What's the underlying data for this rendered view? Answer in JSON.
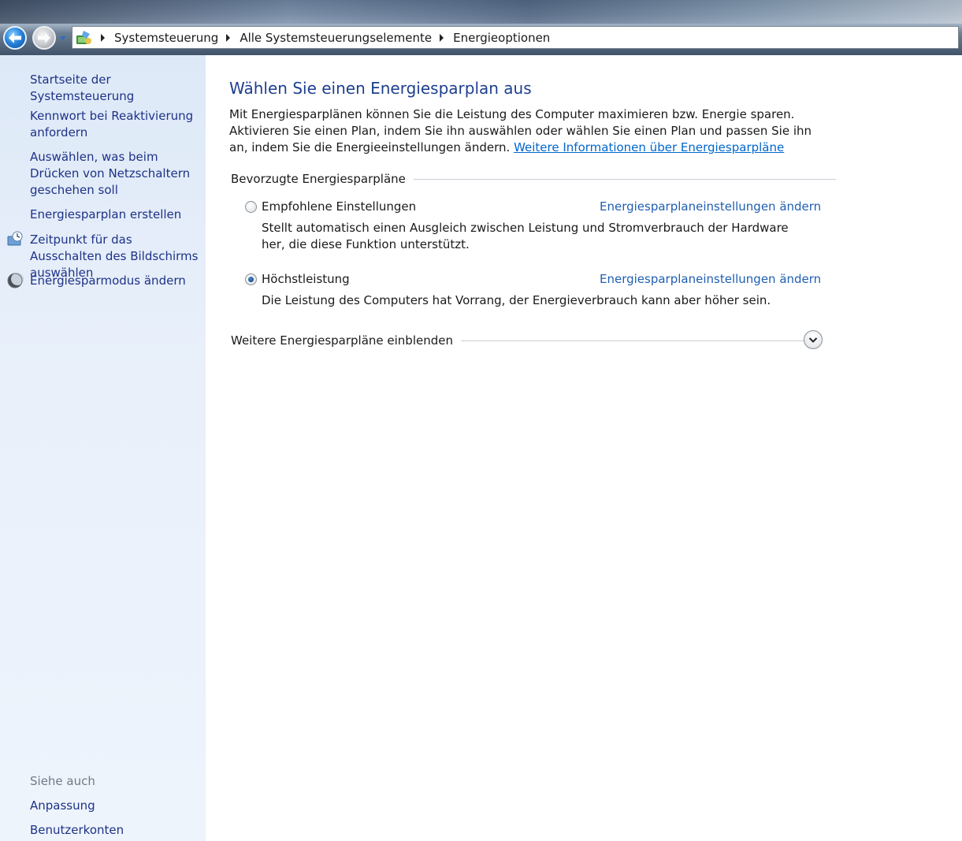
{
  "addressbar": {
    "breadcrumbs": [
      "Systemsteuerung",
      "Alle Systemsteuerungselemente",
      "Energieoptionen"
    ]
  },
  "sidebar": {
    "items": [
      {
        "label": "Startseite der Systemsteuerung",
        "icon": null
      },
      {
        "label": "Kennwort bei Reaktivierung anfordern",
        "icon": null
      },
      {
        "label": "Auswählen, was beim Drücken von Netzschaltern geschehen soll",
        "icon": null
      },
      {
        "label": "Energiesparplan erstellen",
        "icon": null
      },
      {
        "label": "Zeitpunkt für das Ausschalten des Bildschirms auswählen",
        "icon": "display-timer-icon"
      },
      {
        "label": "Energiesparmodus ändern",
        "icon": "moon-icon"
      }
    ],
    "see_also": {
      "heading": "Siehe auch",
      "items": [
        "Anpassung",
        "Benutzerkonten"
      ]
    }
  },
  "main": {
    "title": "Wählen Sie einen Energiesparplan aus",
    "intro": "Mit Energiesparplänen können Sie die Leistung des Computer maximieren bzw. Energie sparen. Aktivieren Sie einen Plan, indem Sie ihn auswählen oder wählen Sie einen Plan und passen Sie ihn an, indem Sie die Energieeinstellungen ändern.",
    "intro_link": "Weitere Informationen über Energiesparpläne",
    "preferred_header": "Bevorzugte Energiesparpläne",
    "plans": [
      {
        "name": "Empfohlene Einstellungen",
        "description": "Stellt automatisch einen Ausgleich zwischen Leistung und Stromverbrauch der Hardware her, die diese Funktion unterstützt.",
        "change_link": "Energiesparplaneinstellungen ändern",
        "selected": false
      },
      {
        "name": "Höchstleistung",
        "description": "Die Leistung des Computers hat Vorrang, der Energieverbrauch kann aber höher sein.",
        "change_link": "Energiesparplaneinstellungen ändern",
        "selected": true
      }
    ],
    "more_plans_header": "Weitere Energiesparpläne einblenden"
  },
  "colors": {
    "link": "#1e3287",
    "accent_title": "#1e3f8f",
    "hyperlink": "#0066cc",
    "sidebar_bg": "#e9f0fa"
  }
}
